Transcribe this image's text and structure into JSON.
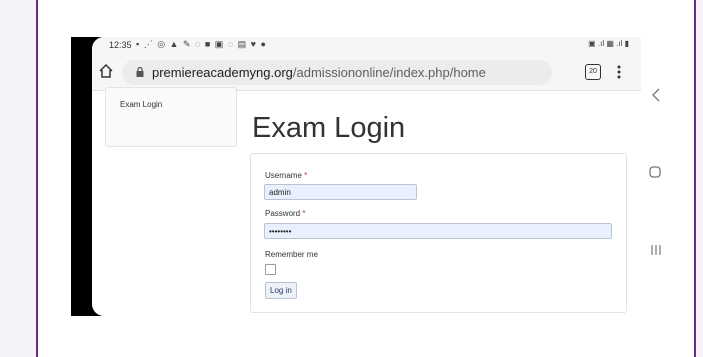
{
  "statusbar": {
    "time": "12:35",
    "icons": "▪ ⋰ ◎ ▲ ✎ ◌ ■ ▣ ◌ ▤ ♥ ●",
    "right_icons": "▣ .ıl ▦ .ıl ▮"
  },
  "browser": {
    "url_domain": "premiereacademyng.org",
    "url_path": "/admissiononline/index.php/home",
    "tab_count": "20"
  },
  "sidebar": {
    "item": "Exam Login"
  },
  "page": {
    "title": "Exam Login"
  },
  "form": {
    "username_label": "Username",
    "username_value": "admin",
    "password_label": "Password",
    "password_value": "••••••••",
    "required_marker": "*",
    "remember_label": "Remember me",
    "login_button": "Log in"
  },
  "colors": {
    "accent_border": "#6a2a86",
    "input_fill": "#e8f0fe"
  }
}
